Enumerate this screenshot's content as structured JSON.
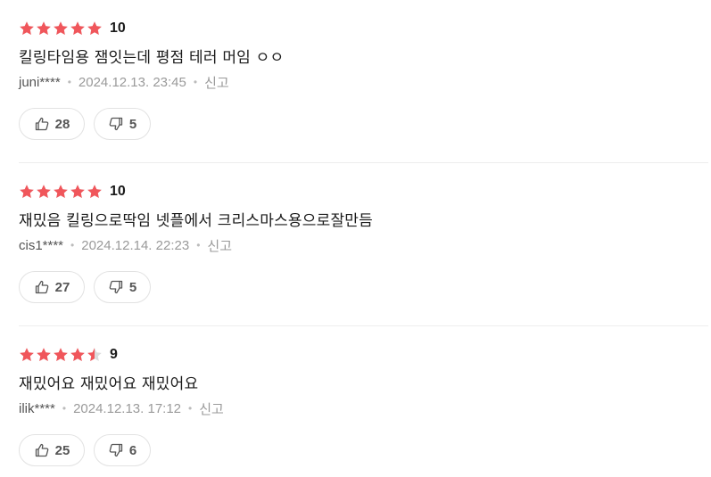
{
  "colors": {
    "star_filled": "#f0565b",
    "star_empty": "#dcdcdc"
  },
  "reviews": [
    {
      "stars": 5,
      "score": "10",
      "comment": "킬링타임용 잼잇는데 평점 테러 머임 ㅇㅇ",
      "user": "juni****",
      "date": "2024.12.13. 23:45",
      "report": "신고",
      "likes": "28",
      "dislikes": "5"
    },
    {
      "stars": 5,
      "score": "10",
      "comment": "재밌음 킬링으로딱임 넷플에서 크리스마스용으로잘만듬",
      "user": "cis1****",
      "date": "2024.12.14. 22:23",
      "report": "신고",
      "likes": "27",
      "dislikes": "5"
    },
    {
      "stars": 4.5,
      "score": "9",
      "comment": "재밌어요 재밌어요 재밌어요",
      "user": "ilik****",
      "date": "2024.12.13. 17:12",
      "report": "신고",
      "likes": "25",
      "dislikes": "6"
    }
  ],
  "icons": {
    "star": "star-icon",
    "like": "thumbs-up-icon",
    "dislike": "thumbs-down-icon"
  }
}
